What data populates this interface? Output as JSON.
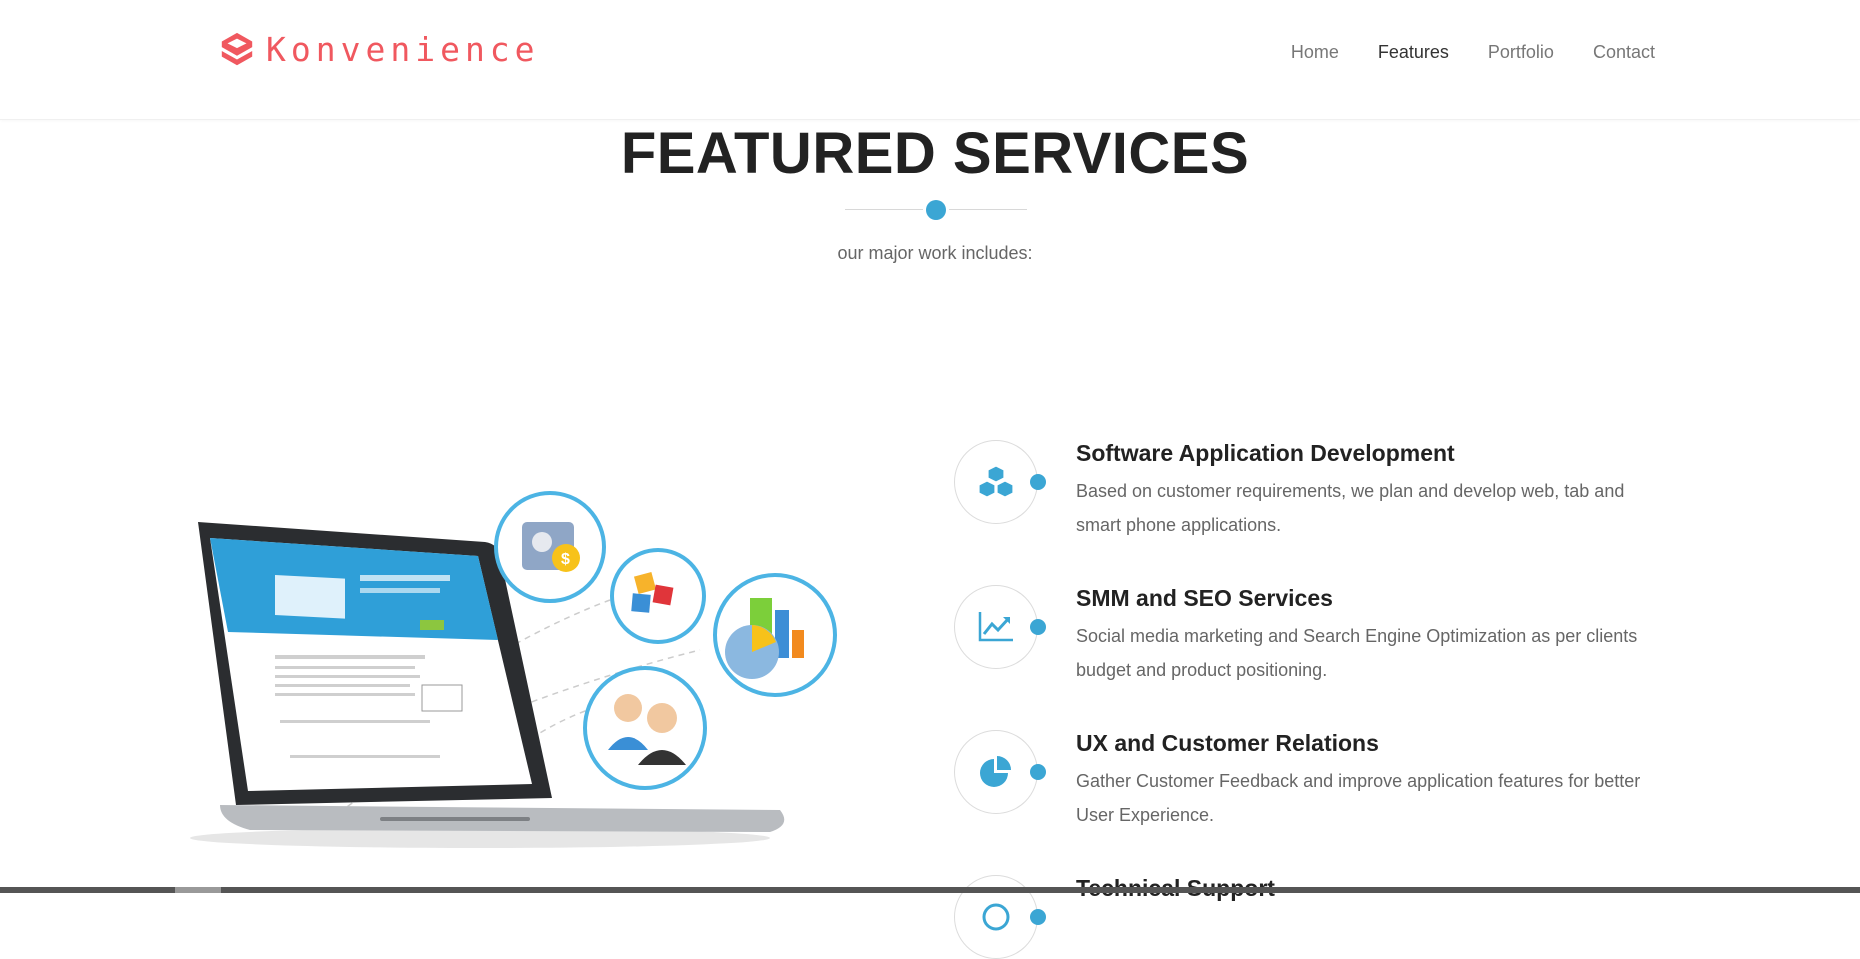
{
  "brand": {
    "name": "Konvenience",
    "color": "#f0585f"
  },
  "nav": {
    "items": [
      {
        "label": "Home",
        "active": false
      },
      {
        "label": "Features",
        "active": true
      },
      {
        "label": "Portfolio",
        "active": false
      },
      {
        "label": "Contact",
        "active": false
      }
    ]
  },
  "section": {
    "title": "FEATURED SERVICES",
    "subtitle": "our major work includes:"
  },
  "hero": {
    "icon": "laptop-illustration"
  },
  "services": [
    {
      "icon": "cubes-icon",
      "title": "Software Application Development",
      "description": "Based on customer requirements, we plan and develop web, tab and smart phone applications."
    },
    {
      "icon": "line-chart-icon",
      "title": "SMM and SEO Services",
      "description": "Social media marketing and Search Engine Optimization as per clients budget and product positioning."
    },
    {
      "icon": "pie-chart-icon",
      "title": "UX and Customer Relations",
      "description": "Gather Customer Feedback and improve application features for better User Experience."
    },
    {
      "icon": "support-icon",
      "title": "Technical Support",
      "description": ""
    }
  ],
  "colors": {
    "accent": "#3ba6d4",
    "heading": "#222222",
    "text": "#666666"
  }
}
